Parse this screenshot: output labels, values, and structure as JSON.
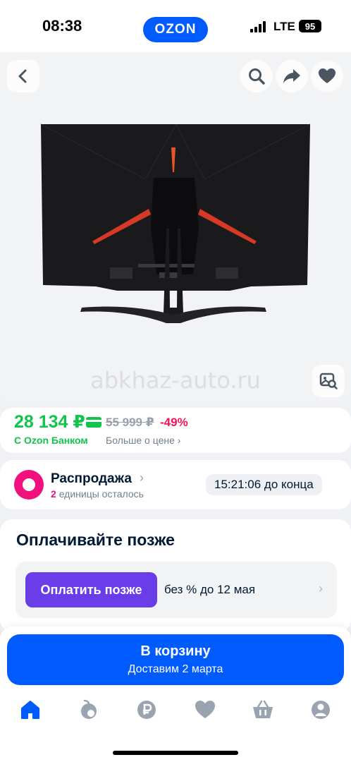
{
  "status": {
    "time": "08:38",
    "network": "LTE",
    "battery": "95"
  },
  "app": {
    "logo": "OZON",
    "brand_color": "#005bff"
  },
  "gallery": {
    "watermark": "abkhaz-auto.ru",
    "icons": [
      "back-arrow-icon",
      "search-icon",
      "share-icon",
      "heart-icon",
      "image-search-icon"
    ]
  },
  "price": {
    "current": "28 134 ₽",
    "old": "55 999 ₽",
    "discount": "-49%",
    "bank_label": "С Ozon Банком",
    "more_label": "Больше о цене",
    "price_color": "#10c44c",
    "discount_color": "#f91155"
  },
  "sale": {
    "title": "Распродажа",
    "units_count": "2",
    "units_text": "единицы осталось",
    "timer": "15:21:06 до конца"
  },
  "paylater": {
    "title": "Оплачивайте позже",
    "button": "Оплатить позже",
    "text": "без % до 12 мая",
    "button_color": "#6a3de8"
  },
  "cart": {
    "title": "В корзину",
    "subtitle": "Доставим 2 марта"
  },
  "nav": {
    "items": [
      "home-icon",
      "fresh-icon",
      "finance-icon",
      "favorites-icon",
      "cart-icon",
      "profile-icon"
    ]
  }
}
